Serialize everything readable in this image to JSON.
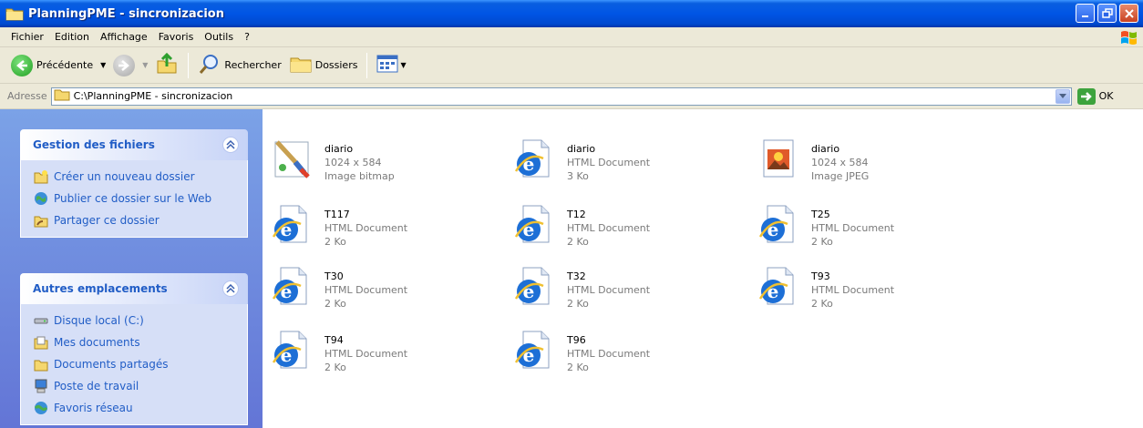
{
  "window": {
    "title": "PlanningPME - sincronizacion"
  },
  "menu": {
    "items": [
      "Fichier",
      "Edition",
      "Affichage",
      "Favoris",
      "Outils",
      "?"
    ]
  },
  "toolbar": {
    "back_label": "Précédente",
    "search_label": "Rechercher",
    "folders_label": "Dossiers"
  },
  "address": {
    "label": "Adresse",
    "value": "C:\\PlanningPME - sincronizacion",
    "go_label": "OK"
  },
  "sidebar": {
    "file_tasks": {
      "title": "Gestion des fichiers",
      "items": [
        "Créer un nouveau dossier",
        "Publier ce dossier sur le Web",
        "Partager ce dossier"
      ]
    },
    "other_places": {
      "title": "Autres emplacements",
      "items": [
        "Disque local (C:)",
        "Mes documents",
        "Documents partagés",
        "Poste de travail",
        "Favoris réseau"
      ]
    }
  },
  "files": [
    {
      "name": "diario",
      "type": "Image bitmap",
      "size": "1024 x 584",
      "icon": "paint-icon"
    },
    {
      "name": "diario",
      "type": "HTML Document",
      "size": "3 Ko",
      "icon": "ie-html-icon"
    },
    {
      "name": "diario",
      "type": "Image JPEG",
      "size": "1024 x 584",
      "icon": "jpeg-icon"
    },
    {
      "name": "T117",
      "type": "HTML Document",
      "size": "2 Ko",
      "icon": "ie-html-icon"
    },
    {
      "name": "T12",
      "type": "HTML Document",
      "size": "2 Ko",
      "icon": "ie-html-icon"
    },
    {
      "name": "T25",
      "type": "HTML Document",
      "size": "2 Ko",
      "icon": "ie-html-icon"
    },
    {
      "name": "T30",
      "type": "HTML Document",
      "size": "2 Ko",
      "icon": "ie-html-icon"
    },
    {
      "name": "T32",
      "type": "HTML Document",
      "size": "2 Ko",
      "icon": "ie-html-icon"
    },
    {
      "name": "T93",
      "type": "HTML Document",
      "size": "2 Ko",
      "icon": "ie-html-icon"
    },
    {
      "name": "T94",
      "type": "HTML Document",
      "size": "2 Ko",
      "icon": "ie-html-icon"
    },
    {
      "name": "T96",
      "type": "HTML Document",
      "size": "2 Ko",
      "icon": "ie-html-icon"
    }
  ],
  "colors": {
    "titlebar": "#0055e5",
    "sidebar_link": "#215dc6",
    "sidebar_bg": "#6f8fde",
    "chrome": "#ece9d8"
  }
}
